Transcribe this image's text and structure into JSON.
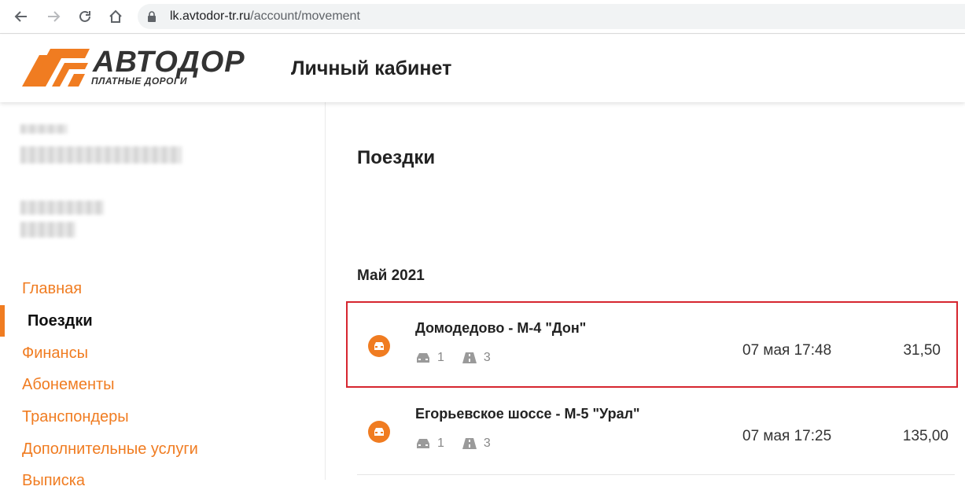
{
  "browser": {
    "url_domain": "lk.avtodor-tr.ru",
    "url_path": "/account/movement"
  },
  "header": {
    "logo_text": "АВТОДОР",
    "logo_subtext": "ПЛАТНЫЕ ДОРОГИ",
    "title": "Личный кабинет"
  },
  "sidebar": {
    "items": [
      {
        "label": "Главная"
      },
      {
        "label": "Поездки"
      },
      {
        "label": "Финансы"
      },
      {
        "label": "Абонементы"
      },
      {
        "label": "Транспондеры"
      },
      {
        "label": "Дополнительные услуги"
      },
      {
        "label": "Выписка"
      }
    ],
    "active_item": "Поездки"
  },
  "main": {
    "title": "Поездки",
    "month": "Май 2021",
    "trips": [
      {
        "name": "Домодедово - М-4 \"Дон\"",
        "vehicle_class": "1",
        "road_count": "3",
        "time": "07 мая 17:48",
        "amount": "31,50"
      },
      {
        "name": "Егорьевское шоссе - М-5 \"Урал\"",
        "vehicle_class": "1",
        "road_count": "3",
        "time": "07 мая 17:25",
        "amount": "135,00"
      }
    ]
  },
  "colors": {
    "accent": "#f07c21",
    "highlight_border": "#d6262f"
  }
}
